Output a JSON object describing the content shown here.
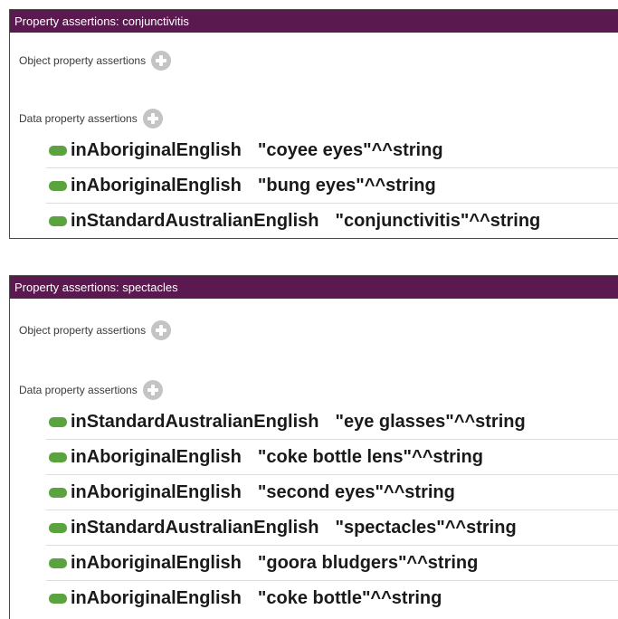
{
  "panels": [
    {
      "title": "Property assertions: conjunctivitis",
      "object_section_label": "Object property assertions",
      "data_section_label": "Data property assertions",
      "rows": [
        {
          "property": "inAboriginalEnglish",
          "value": "\"coyee eyes\"^^string"
        },
        {
          "property": "inAboriginalEnglish",
          "value": "\"bung eyes\"^^string"
        },
        {
          "property": "inStandardAustralianEnglish",
          "value": "\"conjunctivitis\"^^string"
        }
      ]
    },
    {
      "title": "Property assertions: spectacles",
      "object_section_label": "Object property assertions",
      "data_section_label": "Data property assertions",
      "rows": [
        {
          "property": "inStandardAustralianEnglish",
          "value": "\"eye glasses\"^^string"
        },
        {
          "property": "inAboriginalEnglish",
          "value": "\"coke bottle lens\"^^string"
        },
        {
          "property": "inAboriginalEnglish",
          "value": "\"second eyes\"^^string"
        },
        {
          "property": "inStandardAustralianEnglish",
          "value": "\"spectacles\"^^string"
        },
        {
          "property": "inAboriginalEnglish",
          "value": "\"goora bludgers\"^^string"
        },
        {
          "property": "inAboriginalEnglish",
          "value": "\"coke bottle\"^^string"
        }
      ]
    }
  ],
  "icons": {
    "add": "add-circle-icon",
    "data_property": "data-property-icon"
  },
  "colors": {
    "header_bg": "#5b1a4f",
    "header_text": "#ffffff",
    "data_property_icon": "#5aa33e",
    "add_button": "#c4c4c4"
  }
}
